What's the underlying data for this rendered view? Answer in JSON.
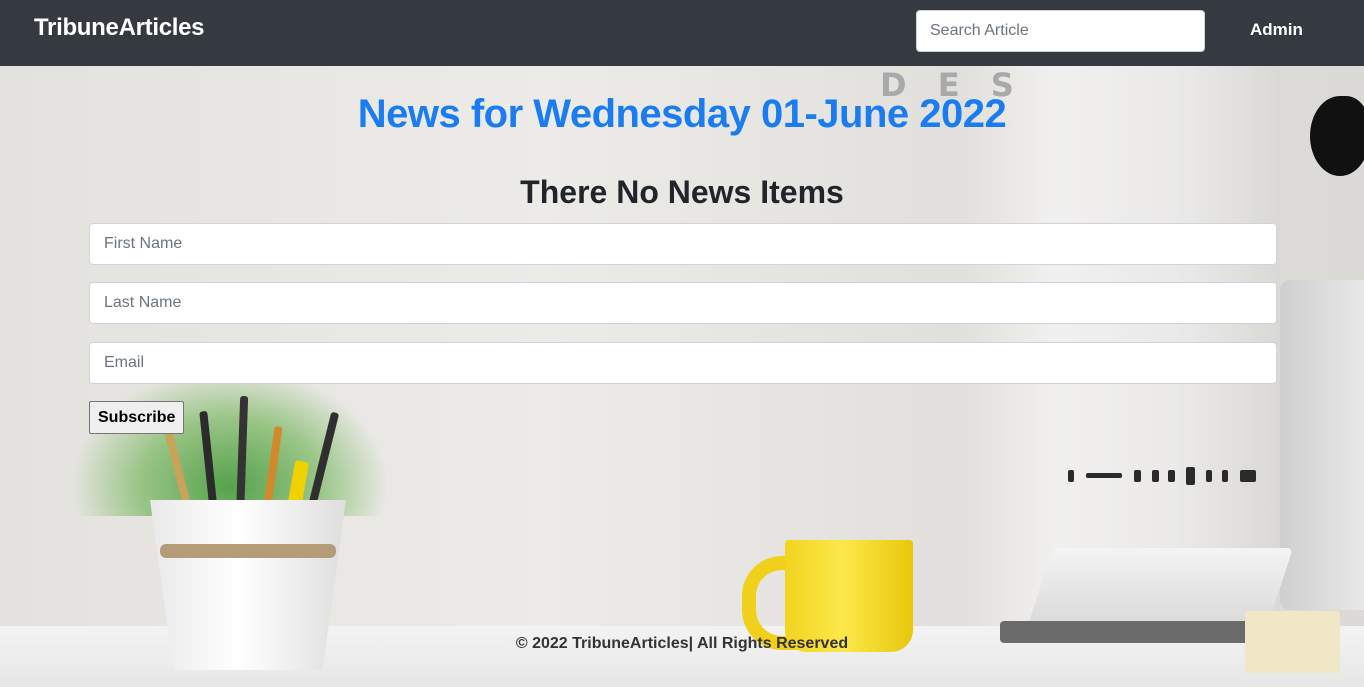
{
  "navbar": {
    "brand": "TribuneArticles",
    "search_placeholder": "Search Article",
    "admin_label": "Admin"
  },
  "main": {
    "date_heading": "News for Wednesday 01-June 2022",
    "empty_message": "There No News Items"
  },
  "subscribe_form": {
    "first_name_placeholder": "First Name",
    "last_name_placeholder": "Last Name",
    "email_placeholder": "Email",
    "submit_label": "Subscribe"
  },
  "footer": {
    "text": "© 2022 TribuneArticles| All Rights Reserved"
  },
  "colors": {
    "navbar_bg": "#343a40",
    "heading_blue": "#1a7cf0"
  }
}
